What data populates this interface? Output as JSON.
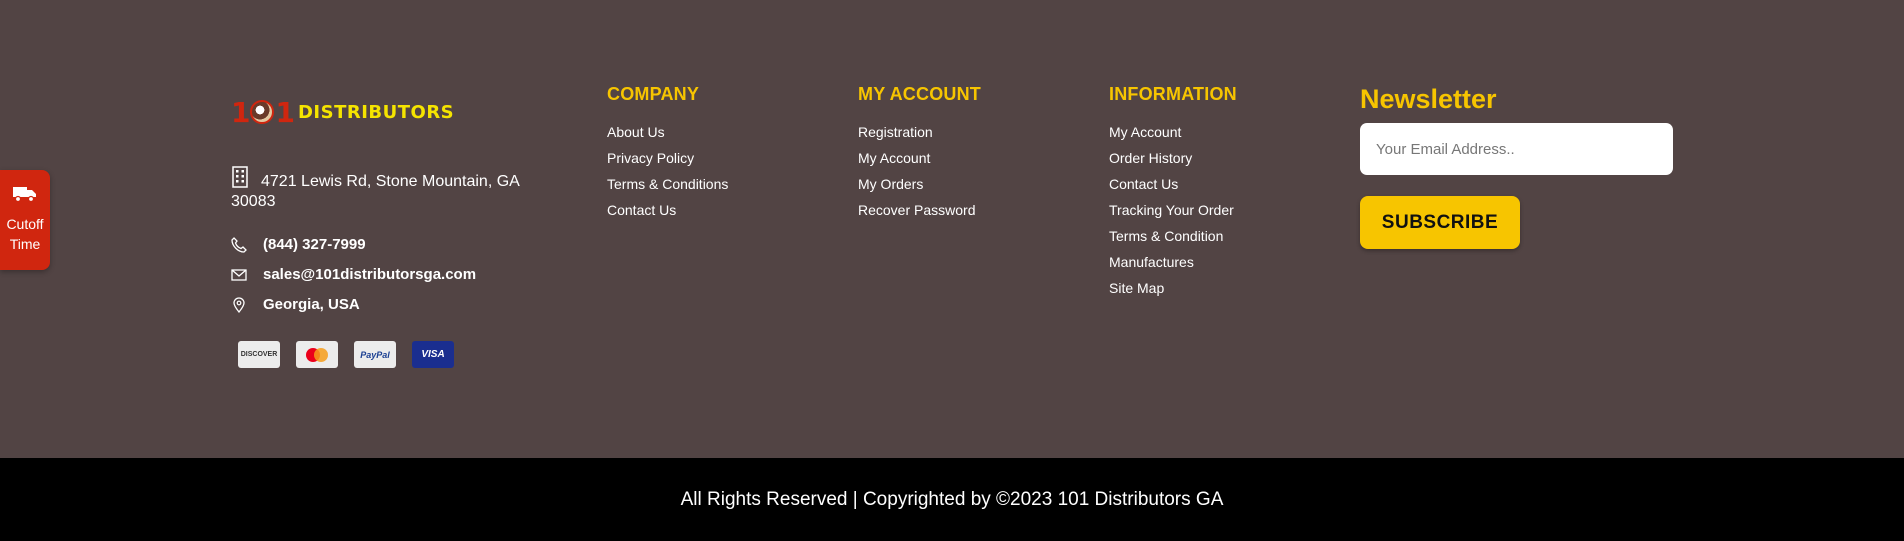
{
  "cutoff": {
    "label": "Cutoff Time",
    "color": "#d0260f"
  },
  "brand": {
    "logo_number": "1 1",
    "logo_name": "DISTRIBUTORS",
    "address": "4721 Lewis Rd, Stone Mountain, GA 30083",
    "phone": "(844) 327-7999",
    "email": "sales@101distributorsga.com",
    "location": "Georgia, USA",
    "payments": [
      "DISCOVER",
      "Mastercard",
      "PayPal",
      "VISA"
    ]
  },
  "company": {
    "title": "COMPANY",
    "links": [
      "About Us",
      "Privacy Policy",
      "Terms & Conditions",
      "Contact Us"
    ]
  },
  "account": {
    "title": "MY ACCOUNT",
    "links": [
      "Registration",
      "My Account",
      "My Orders",
      "Recover Password"
    ]
  },
  "information": {
    "title": "INFORMATION",
    "links": [
      "My Account",
      "Order History",
      "Contact Us",
      "Tracking Your Order",
      "Terms & Condition",
      "Manufactures",
      "Site Map"
    ]
  },
  "newsletter": {
    "title": "Newsletter",
    "placeholder": "Your Email Address..",
    "button": "SUBSCRIBE"
  },
  "footer": {
    "copyright": "All Rights Reserved | Copyrighted by ©2023 101 Distributors GA"
  },
  "colors": {
    "background": "#524444",
    "accent": "#f7c500",
    "bottom_bar": "#000000"
  }
}
